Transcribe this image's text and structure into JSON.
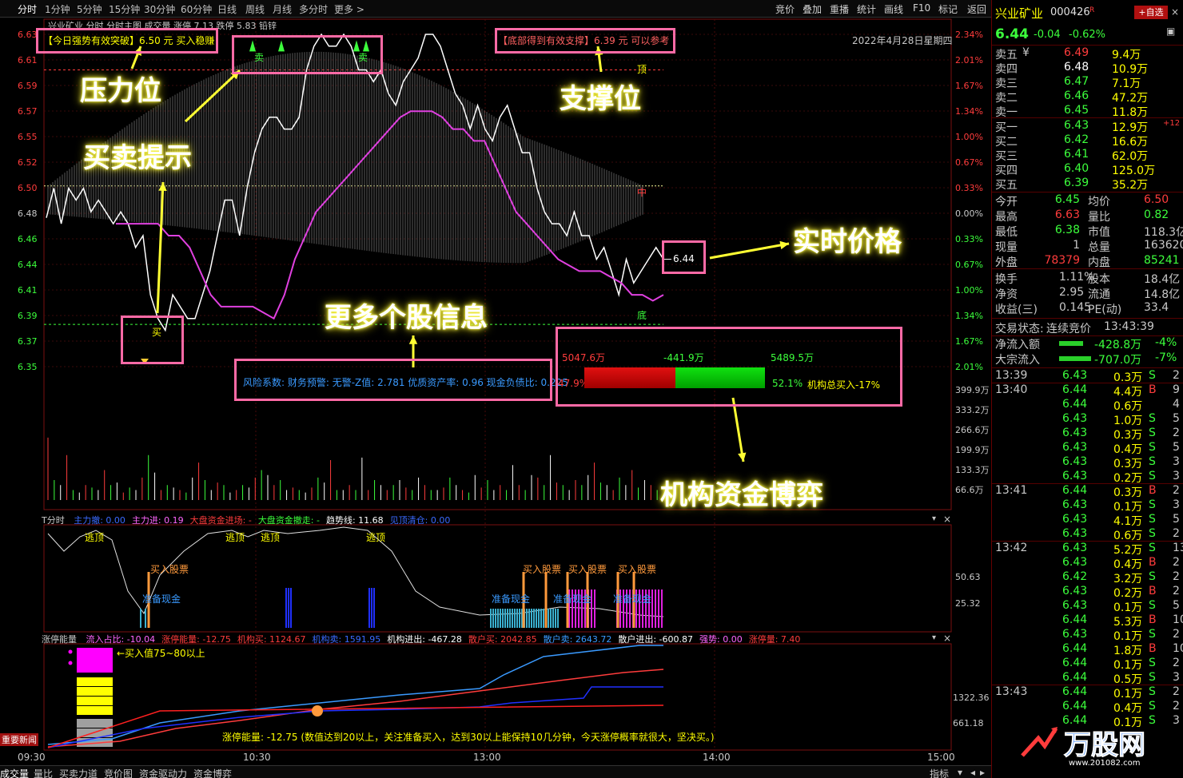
{
  "toolbar": {
    "periods": [
      "分时",
      "1分钟",
      "5分钟",
      "15分钟",
      "30分钟",
      "60分钟",
      "日线",
      "周线",
      "月线",
      "多分时",
      "更多 >"
    ],
    "right_buttons": [
      "竞价",
      "叠加",
      "重播",
      "统计",
      "画线",
      "F10",
      "标记",
      "返回"
    ]
  },
  "main_chart": {
    "header": "兴业矿业  分时 分时主图  成交量  涨停 7.13  跌停 5.83  铅锌",
    "date": "2022年4月28日星期四",
    "price_ticks": [
      "6.63",
      "6.61",
      "6.59",
      "6.57",
      "6.55",
      "6.52",
      "6.50",
      "6.48",
      "6.46",
      "6.44",
      "6.41",
      "6.39",
      "6.37",
      "6.35"
    ],
    "pct_ticks": [
      "2.34%",
      "2.01%",
      "1.67%",
      "1.34%",
      "1.00%",
      "0.67%",
      "0.33%",
      "0.00%",
      "0.33%",
      "0.67%",
      "1.00%",
      "1.34%",
      "1.67%",
      "2.01%"
    ],
    "vol_ticks": [
      "399.9万",
      "333.2万",
      "266.6万",
      "199.9万",
      "133.3万",
      "66.6万"
    ],
    "resistance_label": "【今日强势有效突破】6.50 元 买入稳赚",
    "support_label": "【底部得到有效支撑】6.39 元 可以参考",
    "top_mark": "顶",
    "mid_mark": "中",
    "bottom_mark": "底",
    "buy_mark": "买",
    "sell_mark": "卖",
    "price_now": "6.44",
    "info_text": "风险系数: 财务预警: 无警-Z值: 2.781 优质资产率: 0.96 现金负债比: 0.225",
    "fund_left": "5047.6万",
    "fund_mid": "-441.9万",
    "fund_right": "5489.5万",
    "fund_pct_left": "47.9%",
    "fund_pct_right": "52.1%",
    "fund_total": "机构总买入-17%"
  },
  "annotations": {
    "resistance": "压力位",
    "support": "支撑位",
    "trade_hint": "买卖提示",
    "realtime_price": "实时价格",
    "more_info": "更多个股信息",
    "fund_game": "机构资金博弈"
  },
  "indicator1": {
    "name": "T分时",
    "items": [
      {
        "label": "主力撤: 0.00",
        "color": "#3a6aff"
      },
      {
        "label": "主力进: 0.19",
        "color": "#ff66ff"
      },
      {
        "label": "大盘资金进场: -",
        "color": "#ff3c3c"
      },
      {
        "label": "大盘资金撤走: -",
        "color": "#3cff3c"
      },
      {
        "label": "趋势线: 11.68",
        "color": "#ffffff"
      },
      {
        "label": "见顶清仓: 0.00",
        "color": "#3a6aff"
      }
    ],
    "escape_label": "逃顶",
    "buy_label": "买入股票",
    "prepare_label": "准备现金",
    "ticks": [
      "50.63",
      "25.32"
    ]
  },
  "indicator2": {
    "name": "涨停能量",
    "items": [
      {
        "label": "流入占比: -10.04",
        "color": "#ff66ff"
      },
      {
        "label": "涨停能量: -12.75",
        "color": "#ff3c3c"
      },
      {
        "label": "机构买: 1124.67",
        "color": "#ff3c3c"
      },
      {
        "label": "机构卖: 1591.95",
        "color": "#3a6aff"
      },
      {
        "label": "机构进出: -467.28",
        "color": "#ffffff"
      },
      {
        "label": "散户买: 2042.85",
        "color": "#ff3c3c"
      },
      {
        "label": "散户卖: 2643.72",
        "color": "#3a9aff"
      },
      {
        "label": "散户进出: -600.87",
        "color": "#ffffff"
      },
      {
        "label": "强势: 0.00",
        "color": "#ff66ff"
      },
      {
        "label": "涨停量: 7.40",
        "color": "#ff3c3c"
      }
    ],
    "legend_note": "←买入值75~80以上",
    "footer_note": "涨停能量: -12.75 (数值达到20以上，关注准备买入，达到30以上能保持10几分钟，今天涨停概率就很大，坚决买。)",
    "ticks": [
      "1322.36",
      "661.18"
    ],
    "news_button": "重要新闻"
  },
  "time_axis": [
    "09:30",
    "10:30",
    "13:00",
    "14:00",
    "15:00"
  ],
  "bottom_tabs": [
    "成交量",
    "量比",
    "买卖力道",
    "竞价图",
    "资金驱动力",
    "资金博弈"
  ],
  "bottom_right": "指标",
  "quote": {
    "name": "兴业矿业",
    "code": "000426",
    "rz": "R",
    "add_button": "+自选",
    "price": "6.44",
    "change": "-0.04",
    "change_pct": "-0.62%",
    "asks": [
      {
        "label": "卖五",
        "flag": "¥",
        "price": "6.49",
        "vol": "9.4万",
        "color": "#ff3c3c"
      },
      {
        "label": "卖四",
        "flag": "",
        "price": "6.48",
        "vol": "10.9万",
        "color": "#ffffff"
      },
      {
        "label": "卖三",
        "flag": "",
        "price": "6.47",
        "vol": "7.1万",
        "color": "#3cff3c"
      },
      {
        "label": "卖二",
        "flag": "",
        "price": "6.46",
        "vol": "47.2万",
        "color": "#3cff3c"
      },
      {
        "label": "卖一",
        "flag": "",
        "price": "6.45",
        "vol": "11.8万",
        "color": "#3cff3c"
      }
    ],
    "bids": [
      {
        "label": "买一",
        "price": "6.43",
        "vol": "12.9万",
        "extra": "+12",
        "color": "#3cff3c"
      },
      {
        "label": "买二",
        "price": "6.42",
        "vol": "16.6万",
        "extra": "",
        "color": "#3cff3c"
      },
      {
        "label": "买三",
        "price": "6.41",
        "vol": "62.0万",
        "extra": "",
        "color": "#3cff3c"
      },
      {
        "label": "买四",
        "price": "6.40",
        "vol": "125.0万",
        "extra": "",
        "color": "#3cff3c"
      },
      {
        "label": "买五",
        "price": "6.39",
        "vol": "35.2万",
        "extra": "",
        "color": "#3cff3c"
      }
    ],
    "stats": [
      {
        "l1": "今开",
        "v1": "6.45",
        "c1": "#3cff3c",
        "l2": "均价",
        "v2": "6.50",
        "c2": "#ff3c3c"
      },
      {
        "l1": "最高",
        "v1": "6.63",
        "c1": "#ff3c3c",
        "l2": "量比",
        "v2": "0.82",
        "c2": "#3cff3c"
      },
      {
        "l1": "最低",
        "v1": "6.38",
        "c1": "#3cff3c",
        "l2": "市值",
        "v2": "118.3亿",
        "c2": "#c8c8c8"
      },
      {
        "l1": "现量",
        "v1": "1",
        "c1": "#c8c8c8",
        "l2": "总量",
        "v2": "163620",
        "c2": "#c8c8c8"
      },
      {
        "l1": "外盘",
        "v1": "78379",
        "c1": "#ff3c3c",
        "l2": "内盘",
        "v2": "85241",
        "c2": "#3cff3c"
      }
    ],
    "stats2": [
      {
        "l1": "换手",
        "v1": "1.11%",
        "l2": "股本",
        "v2": "18.4亿"
      },
      {
        "l1": "净资",
        "v1": "2.95",
        "l2": "流通",
        "v2": "14.8亿"
      },
      {
        "l1": "收益(三)",
        "v1": "0.145",
        "l2": "PE(动)",
        "v2": "33.4"
      }
    ],
    "trade_status_label": "交易状态:",
    "trade_status": "连续竞价",
    "trade_time": "13:43:39",
    "flows": [
      {
        "label": "净流入额",
        "value": "-428.8万",
        "pct": "-4%"
      },
      {
        "label": "大宗流入",
        "value": "-707.0万",
        "pct": "-7%"
      }
    ],
    "ticks_groups": [
      {
        "time": "13:39",
        "rows": [
          [
            "6.43",
            "0.3万",
            "S",
            "2"
          ]
        ]
      },
      {
        "time": "13:40",
        "rows": [
          [
            "6.44",
            "4.4万",
            "B",
            "9"
          ],
          [
            "6.44",
            "0.6万",
            "",
            "4"
          ],
          [
            "6.43",
            "1.0万",
            "S",
            "5"
          ],
          [
            "6.43",
            "0.3万",
            "S",
            "2"
          ],
          [
            "6.43",
            "0.4万",
            "S",
            "5"
          ],
          [
            "6.43",
            "0.3万",
            "S",
            "3"
          ],
          [
            "6.43",
            "0.2万",
            "S",
            "3"
          ]
        ]
      },
      {
        "time": "13:41",
        "rows": [
          [
            "6.44",
            "0.3万",
            "B",
            "2"
          ],
          [
            "6.43",
            "0.1万",
            "S",
            "3"
          ],
          [
            "6.43",
            "4.1万",
            "S",
            "5"
          ],
          [
            "6.43",
            "0.6万",
            "S",
            "2"
          ]
        ]
      },
      {
        "time": "13:42",
        "rows": [
          [
            "6.43",
            "5.2万",
            "S",
            "13"
          ],
          [
            "6.43",
            "0.4万",
            "B",
            "2"
          ],
          [
            "6.42",
            "3.2万",
            "S",
            "2"
          ],
          [
            "6.43",
            "0.2万",
            "B",
            "2"
          ],
          [
            "6.43",
            "0.1万",
            "S",
            "5"
          ],
          [
            "6.44",
            "5.3万",
            "B",
            "10"
          ],
          [
            "6.43",
            "0.1万",
            "S",
            "2"
          ],
          [
            "6.44",
            "1.8万",
            "B",
            "10"
          ],
          [
            "6.44",
            "0.1万",
            "S",
            "2"
          ],
          [
            "6.44",
            "0.5万",
            "S",
            "3"
          ]
        ]
      },
      {
        "time": "13:43",
        "rows": [
          [
            "6.44",
            "0.1万",
            "S",
            "2"
          ],
          [
            "6.44",
            "0.4万",
            "S",
            "2"
          ],
          [
            "6.44",
            "0.1万",
            "S",
            "3"
          ]
        ]
      }
    ]
  },
  "series": {
    "price": [
      6.475,
      6.5,
      6.47,
      6.5,
      6.49,
      6.5,
      6.48,
      6.49,
      6.48,
      6.47,
      6.48,
      6.47,
      6.45,
      6.46,
      6.41,
      6.39,
      6.38,
      6.41,
      6.4,
      6.39,
      6.39,
      6.41,
      6.43,
      6.46,
      6.49,
      6.49,
      6.46,
      6.5,
      6.53,
      6.55,
      6.56,
      6.56,
      6.55,
      6.55,
      6.56,
      6.6,
      6.62,
      6.63,
      6.62,
      6.62,
      6.63,
      6.62,
      6.6,
      6.6,
      6.59,
      6.6,
      6.58,
      6.57,
      6.59,
      6.6,
      6.61,
      6.63,
      6.63,
      6.62,
      6.6,
      6.58,
      6.57,
      6.55,
      6.57,
      6.55,
      6.54,
      6.56,
      6.57,
      6.55,
      6.53,
      6.53,
      6.5,
      6.48,
      6.47,
      6.47,
      6.46,
      6.48,
      6.46,
      6.46,
      6.44,
      6.45,
      6.43,
      6.41,
      6.44,
      6.42,
      6.43,
      6.44,
      6.45,
      6.44
    ],
    "avg": [
      6.47,
      6.47,
      6.47,
      6.47,
      6.47,
      6.46,
      6.46,
      6.45,
      6.43,
      6.41,
      6.4,
      6.4,
      6.4,
      6.4,
      6.395,
      6.39,
      6.41,
      6.44,
      6.46,
      6.48,
      6.49,
      6.5,
      6.51,
      6.52,
      6.53,
      6.54,
      6.55,
      6.56,
      6.565,
      6.565,
      6.565,
      6.56,
      6.55,
      6.55,
      6.54,
      6.54,
      6.52,
      6.5,
      6.48,
      6.47,
      6.46,
      6.45,
      6.44,
      6.435,
      6.43,
      6.43,
      6.43,
      6.425,
      6.42,
      6.41,
      6.41,
      6.405,
      6.41
    ],
    "volume": [
      250,
      80,
      60,
      180,
      40,
      30,
      60,
      50,
      40,
      120,
      60,
      70,
      30,
      50,
      40,
      90,
      180,
      110,
      40,
      60,
      50,
      40,
      30,
      90,
      150,
      80,
      40,
      70,
      60,
      30,
      40,
      60,
      50,
      90,
      120,
      100,
      60,
      80,
      40,
      50,
      40,
      30,
      50,
      90,
      70,
      160,
      40,
      40,
      60,
      40,
      170,
      40,
      80,
      60,
      40,
      60,
      80,
      50,
      40,
      90,
      60,
      40,
      40,
      50,
      90,
      60,
      40,
      30,
      100,
      50,
      80,
      40,
      60,
      40,
      140,
      60,
      40,
      100,
      90,
      60,
      180,
      70,
      60,
      40,
      80,
      60,
      100,
      150,
      70,
      60,
      40,
      90,
      60,
      120,
      50,
      80,
      60,
      40
    ]
  }
}
